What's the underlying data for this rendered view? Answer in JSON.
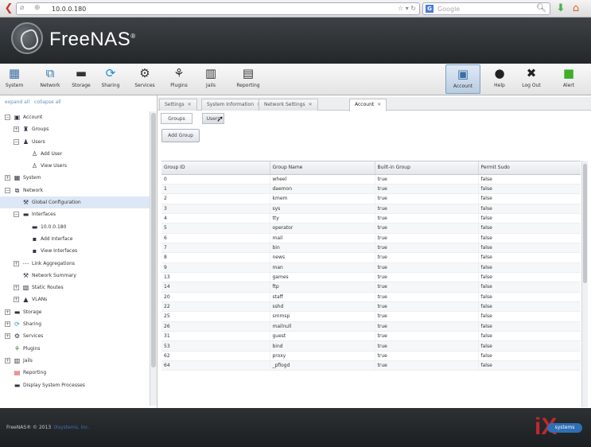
{
  "browser": {
    "url": "10.0.0.180",
    "search_placeholder": "Google",
    "search_engine_letter": "G"
  },
  "app": {
    "title": "FreeNAS",
    "title_mark": "®"
  },
  "toolbar": {
    "left": [
      {
        "label": "System",
        "icon": "system-icon",
        "color": "#3a6ea5"
      },
      {
        "label": "Network",
        "icon": "network-icon",
        "color": "#2d77b7"
      },
      {
        "label": "Storage",
        "icon": "storage-icon",
        "color": "#333"
      },
      {
        "label": "Sharing",
        "icon": "sharing-icon",
        "color": "#1f8ad8"
      },
      {
        "label": "Services",
        "icon": "services-icon",
        "color": "#333"
      },
      {
        "label": "Plugins",
        "icon": "plugins-icon",
        "color": "#333"
      },
      {
        "label": "Jails",
        "icon": "jails-icon",
        "color": "#333"
      },
      {
        "label": "Reporting",
        "icon": "reporting-icon",
        "color": "#333"
      }
    ],
    "right": [
      {
        "label": "Account",
        "icon": "account-icon",
        "color": "#3a6ea5"
      },
      {
        "label": "Help",
        "icon": "help-icon",
        "color": "#222"
      },
      {
        "label": "Log Out",
        "icon": "logout-icon",
        "color": "#222"
      },
      {
        "label": "Alert",
        "icon": "alert-icon",
        "color": "#3fae2a"
      }
    ]
  },
  "tree": {
    "expand_all": "expand all",
    "collapse_all": "collapse all",
    "nodes": [
      {
        "label": "Account",
        "icon": "account-icon",
        "level": 0,
        "toggle": "−"
      },
      {
        "label": "Groups",
        "icon": "groups-icon",
        "level": 1,
        "toggle": "+"
      },
      {
        "label": "Users",
        "icon": "users-icon",
        "level": 1,
        "toggle": "−"
      },
      {
        "label": "Add User",
        "icon": "add-user-icon",
        "level": 2,
        "toggle": ""
      },
      {
        "label": "View Users",
        "icon": "view-users-icon",
        "level": 2,
        "toggle": ""
      },
      {
        "label": "System",
        "icon": "system-icon",
        "level": 0,
        "toggle": "+"
      },
      {
        "label": "Network",
        "icon": "network-icon",
        "level": 0,
        "toggle": "−"
      },
      {
        "label": "Global Configuration",
        "icon": "wrench-icon",
        "level": 1,
        "toggle": "",
        "selected": true
      },
      {
        "label": "Interfaces",
        "icon": "interfaces-icon",
        "level": 1,
        "toggle": "−"
      },
      {
        "label": "10.0.0.180",
        "icon": "interface-icon",
        "level": 2,
        "toggle": ""
      },
      {
        "label": "Add Interface",
        "icon": "add-interface-icon",
        "level": 2,
        "toggle": ""
      },
      {
        "label": "View Interfaces",
        "icon": "view-interfaces-icon",
        "level": 2,
        "toggle": ""
      },
      {
        "label": "Link Aggregations",
        "icon": "link-aggregation-icon",
        "level": 1,
        "toggle": "+"
      },
      {
        "label": "Network Summary",
        "icon": "wrench-icon",
        "level": 1,
        "toggle": ""
      },
      {
        "label": "Static Routes",
        "icon": "static-routes-icon",
        "level": 1,
        "toggle": "+"
      },
      {
        "label": "VLANs",
        "icon": "vlans-icon",
        "level": 1,
        "toggle": "+"
      },
      {
        "label": "Storage",
        "icon": "storage-icon",
        "level": 0,
        "toggle": "+"
      },
      {
        "label": "Sharing",
        "icon": "sharing-icon",
        "level": 0,
        "toggle": "+"
      },
      {
        "label": "Services",
        "icon": "services-icon",
        "level": 0,
        "toggle": "+"
      },
      {
        "label": "Plugins",
        "icon": "plugins-icon",
        "level": 0,
        "toggle": ""
      },
      {
        "label": "Jails",
        "icon": "jails-icon",
        "level": 0,
        "toggle": "+"
      },
      {
        "label": "Reporting",
        "icon": "reporting-icon",
        "level": 0,
        "toggle": ""
      },
      {
        "label": "Display System Processes",
        "icon": "processes-icon",
        "level": 0,
        "toggle": ""
      }
    ]
  },
  "tabs": [
    {
      "label": "Settings",
      "active": false
    },
    {
      "label": "System Information",
      "active": false
    },
    {
      "label": "Network Settings",
      "active": false
    },
    {
      "label": "Account",
      "active": true
    }
  ],
  "subtabs": [
    {
      "label": "Groups",
      "active": true
    },
    {
      "label": "Users",
      "active": false
    }
  ],
  "add_group_label": "Add Group",
  "grid": {
    "columns": [
      "Group ID",
      "Group Name",
      "Built-in Group",
      "Permit Sudo"
    ],
    "rows": [
      [
        "0",
        "wheel",
        "true",
        "false"
      ],
      [
        "1",
        "daemon",
        "true",
        "false"
      ],
      [
        "2",
        "kmem",
        "true",
        "false"
      ],
      [
        "3",
        "sys",
        "true",
        "false"
      ],
      [
        "4",
        "tty",
        "true",
        "false"
      ],
      [
        "5",
        "operator",
        "true",
        "false"
      ],
      [
        "6",
        "mail",
        "true",
        "false"
      ],
      [
        "7",
        "bin",
        "true",
        "false"
      ],
      [
        "8",
        "news",
        "true",
        "false"
      ],
      [
        "9",
        "man",
        "true",
        "false"
      ],
      [
        "13",
        "games",
        "true",
        "false"
      ],
      [
        "14",
        "ftp",
        "true",
        "false"
      ],
      [
        "20",
        "staff",
        "true",
        "false"
      ],
      [
        "22",
        "sshd",
        "true",
        "false"
      ],
      [
        "25",
        "smmsp",
        "true",
        "false"
      ],
      [
        "26",
        "mailnull",
        "true",
        "false"
      ],
      [
        "31",
        "guest",
        "true",
        "false"
      ],
      [
        "53",
        "bind",
        "true",
        "false"
      ],
      [
        "62",
        "proxy",
        "true",
        "false"
      ],
      [
        "64",
        "_pflogd",
        "true",
        "false"
      ]
    ]
  },
  "footer": {
    "copyright": "FreeNAS® © 2013",
    "company": "iXsystems, Inc.",
    "logo_text": "systems"
  }
}
